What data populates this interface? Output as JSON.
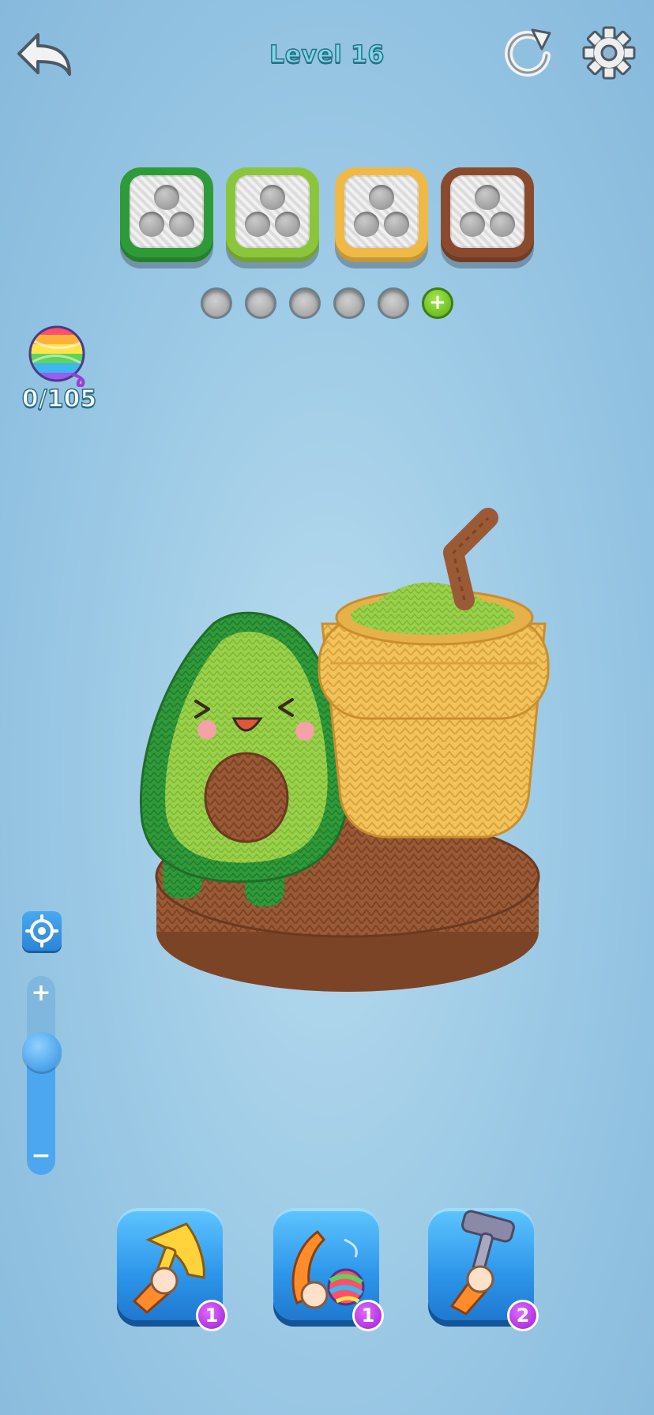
{
  "header": {
    "level_title": "Level 16",
    "back_icon": "back-arrow-icon",
    "restart_icon": "restart-icon",
    "settings_icon": "gear-icon"
  },
  "slots": [
    {
      "color": "#2e9b38",
      "holes": 3
    },
    {
      "color": "#8bc63a",
      "holes": 3
    },
    {
      "color": "#f0b845",
      "holes": 3
    },
    {
      "color": "#8a4a2e",
      "holes": 3
    }
  ],
  "queue": {
    "empty_slots": 5,
    "add_icon": "plus-icon",
    "add_label": "+"
  },
  "yarn": {
    "icon": "yarn-ball-icon",
    "count": "0/105"
  },
  "zoom": {
    "focus_icon": "target-icon",
    "plus": "+",
    "minus": "−",
    "level": 0.75
  },
  "boosters": [
    {
      "icon": "hammer-hand-icon",
      "count": "1"
    },
    {
      "icon": "yarn-throw-hand-icon",
      "count": "1"
    },
    {
      "icon": "shaver-hand-icon",
      "count": "2"
    }
  ],
  "scene": {
    "model": "knitted avocado and smoothie cup"
  }
}
